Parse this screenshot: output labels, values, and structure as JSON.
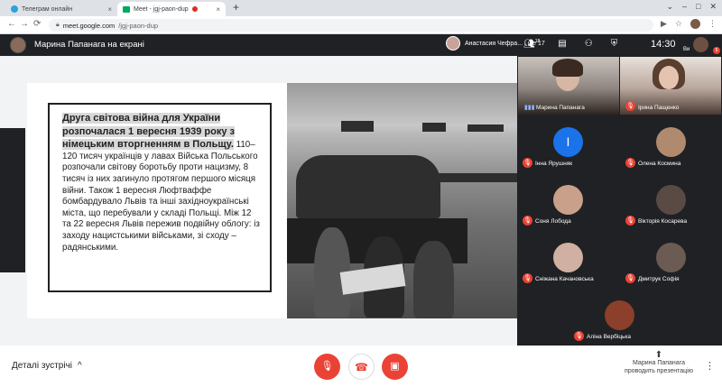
{
  "browser": {
    "tabs": [
      {
        "title": "Телеграм онлайн",
        "close": "×"
      },
      {
        "title": "Meet - jgj-paon-dup",
        "close": "×"
      }
    ],
    "newtab": "+",
    "url": {
      "host": "meet.google.com",
      "path": "/jgj-paon-dup"
    }
  },
  "meet": {
    "presenting_title": "Марина Папанага на екрані",
    "participants_text": "Анастасия Чефра... і ще 17",
    "people_count": "18",
    "time": "14:30",
    "me_label": "Ви",
    "badge": "5"
  },
  "slide": {
    "heading": "Друга світова війна для України розпочалася 1 вересня 1939 року з німецьким вторгненням в Польщу.",
    "body": " 110–120 тисяч українців у лавах Війська Польського розпочали світову боротьбу проти нацизму, 8 тисяч із них загинуло протягом першого місяця війни. Також 1 вересня Люфтваффе бомбардувало Львів та інші західноукраїнські міста, що перебували у складі Польщі. Між 12 та 22 вересня Львів пережив подвійну облогу: із заходу нацистськими військами, зі сходу – радянськими."
  },
  "tiles": {
    "top": [
      {
        "name": "Марина Папанага"
      },
      {
        "name": "Ірина Пащенко"
      }
    ],
    "grid": [
      {
        "name": "Інна Ярушняк",
        "letter": "І",
        "color": "#1a73e8"
      },
      {
        "name": "Олена Космина",
        "color": "#b08a6e"
      },
      {
        "name": "Соня Лобода",
        "color": "#c9a08a"
      },
      {
        "name": "Вікторія Косарева",
        "color": "#5a4a44"
      },
      {
        "name": "Сніжана Качановська",
        "color": "#d0b0a2"
      },
      {
        "name": "Дмитрук Софія",
        "color": "#6b5b52"
      },
      {
        "name": "Аліна Вербіцька",
        "color": "#8c3f2a"
      }
    ]
  },
  "bottom": {
    "details": "Деталі зустрічі",
    "chevron": "^",
    "present_line1": "Марина Папанага",
    "present_line2": "проводить презентацію",
    "more": "⋮"
  },
  "colors": {
    "danger": "#ea4335",
    "blue": "#1a73e8",
    "dark": "#202124"
  }
}
